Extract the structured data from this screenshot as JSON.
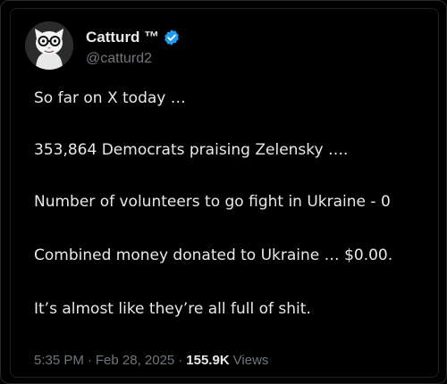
{
  "author": {
    "display_name": "Catturd ™",
    "handle": "@catturd2",
    "verified_color": "#1d9bf0",
    "avatar_icon": "cartoon-cat-with-glasses-avatar"
  },
  "tweet": {
    "lines": [
      "So far on X today …",
      "353,864 Democrats praising Zelensky ….",
      "Number of volunteers to go fight in Ukraine - 0",
      "Combined money donated to Ukraine … $0.00.",
      "It’s almost like they’re all full of shit."
    ]
  },
  "meta": {
    "time": "5:35 PM",
    "separator": "·",
    "date": "Feb 28, 2025",
    "views_count": "155.9K",
    "views_label": "Views"
  }
}
